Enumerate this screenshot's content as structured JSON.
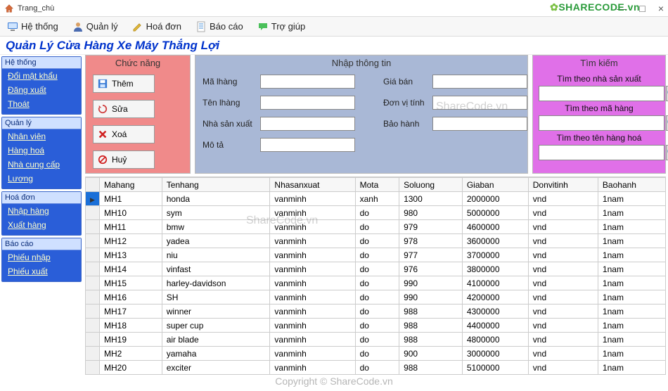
{
  "window": {
    "title": "Trang_chù"
  },
  "controls": {
    "min": "—",
    "max": "□",
    "close": "×"
  },
  "menu": [
    {
      "icon": "monitor",
      "label": "Hệ thống"
    },
    {
      "icon": "person",
      "label": "Quản lý"
    },
    {
      "icon": "pencil",
      "label": "Hoá đơn"
    },
    {
      "icon": "doc",
      "label": "Báo cáo"
    },
    {
      "icon": "bubble",
      "label": "Trợ giúp"
    }
  ],
  "app_title": "Quản Lý Cửa Hàng Xe Máy Thắng Lợi",
  "sidebar": [
    {
      "header": "Hệ thống",
      "items": [
        "Đổi mật khẩu",
        "Đăng xuất",
        "Thoát"
      ]
    },
    {
      "header": "Quản lý",
      "items": [
        "Nhân viên",
        "Hàng hoá",
        "Nhà cung cấp",
        "Lương"
      ]
    },
    {
      "header": "Hoá đơn",
      "items": [
        "Nhập hàng",
        "Xuất hàng"
      ]
    },
    {
      "header": "Báo cáo",
      "items": [
        "Phiếu nhập",
        "Phiếu xuất"
      ]
    }
  ],
  "funcs": {
    "title": "Chức năng",
    "buttons": [
      {
        "icon": "save",
        "label": "Thêm"
      },
      {
        "icon": "refresh",
        "label": "Sửa"
      },
      {
        "icon": "x",
        "label": "Xoá"
      },
      {
        "icon": "no",
        "label": "Huỷ"
      }
    ]
  },
  "inputs": {
    "title": "Nhập thông tin",
    "left_labels": [
      "Mã lhàng",
      "Tên lhàng",
      "Nhà sản xuất",
      "Mô tả"
    ],
    "right_labels": [
      "Giá bán",
      "Đơn vị tính",
      "Bảo hành"
    ]
  },
  "search": {
    "title": "Tìm kiếm",
    "labels": [
      "Tìm theo nhà sản xuất",
      "Tìm theo mã hàng",
      "Tìm theo tên hàng hoá"
    ]
  },
  "grid": {
    "columns": [
      "Mahang",
      "Tenhang",
      "Nhasanxuat",
      "Mota",
      "Soluong",
      "Giaban",
      "Donvitinh",
      "Baohanh"
    ],
    "rows": [
      [
        "MH1",
        "honda",
        "vanminh",
        "xanh",
        "1300",
        "2000000",
        "vnd",
        "1nam"
      ],
      [
        "MH10",
        "sym",
        "vanminh",
        "do",
        "980",
        "5000000",
        "vnd",
        "1nam"
      ],
      [
        "MH11",
        "bmw",
        "vanminh",
        "do",
        "979",
        "4600000",
        "vnd",
        "1nam"
      ],
      [
        "MH12",
        "yadea",
        "vanminh",
        "do",
        "978",
        "3600000",
        "vnd",
        "1nam"
      ],
      [
        "MH13",
        "niu",
        "vanminh",
        "do",
        "977",
        "3700000",
        "vnd",
        "1nam"
      ],
      [
        "MH14",
        "vinfast",
        "vanminh",
        "do",
        "976",
        "3800000",
        "vnd",
        "1nam"
      ],
      [
        "MH15",
        "harley-davidson",
        "vanminh",
        "do",
        "990",
        "4100000",
        "vnd",
        "1nam"
      ],
      [
        "MH16",
        "SH",
        "vanminh",
        "do",
        "990",
        "4200000",
        "vnd",
        "1nam"
      ],
      [
        "MH17",
        "winner",
        "vanminh",
        "do",
        "988",
        "4300000",
        "vnd",
        "1nam"
      ],
      [
        "MH18",
        "super cup",
        "vanminh",
        "do",
        "988",
        "4400000",
        "vnd",
        "1nam"
      ],
      [
        "MH19",
        "air blade",
        "vanminh",
        "do",
        "988",
        "4800000",
        "vnd",
        "1nam"
      ],
      [
        "MH2",
        "yamaha",
        "vanminh",
        "do",
        "900",
        "3000000",
        "vnd",
        "1nam"
      ],
      [
        "MH20",
        "exciter",
        "vanminh",
        "do",
        "988",
        "5100000",
        "vnd",
        "1nam"
      ]
    ]
  },
  "watermarks": {
    "logo": "SHARECODE.vn",
    "wm1": "ShareCode.vn",
    "wm2": "ShareCode.vn",
    "copyright": "Copyright © ShareCode.vn"
  }
}
